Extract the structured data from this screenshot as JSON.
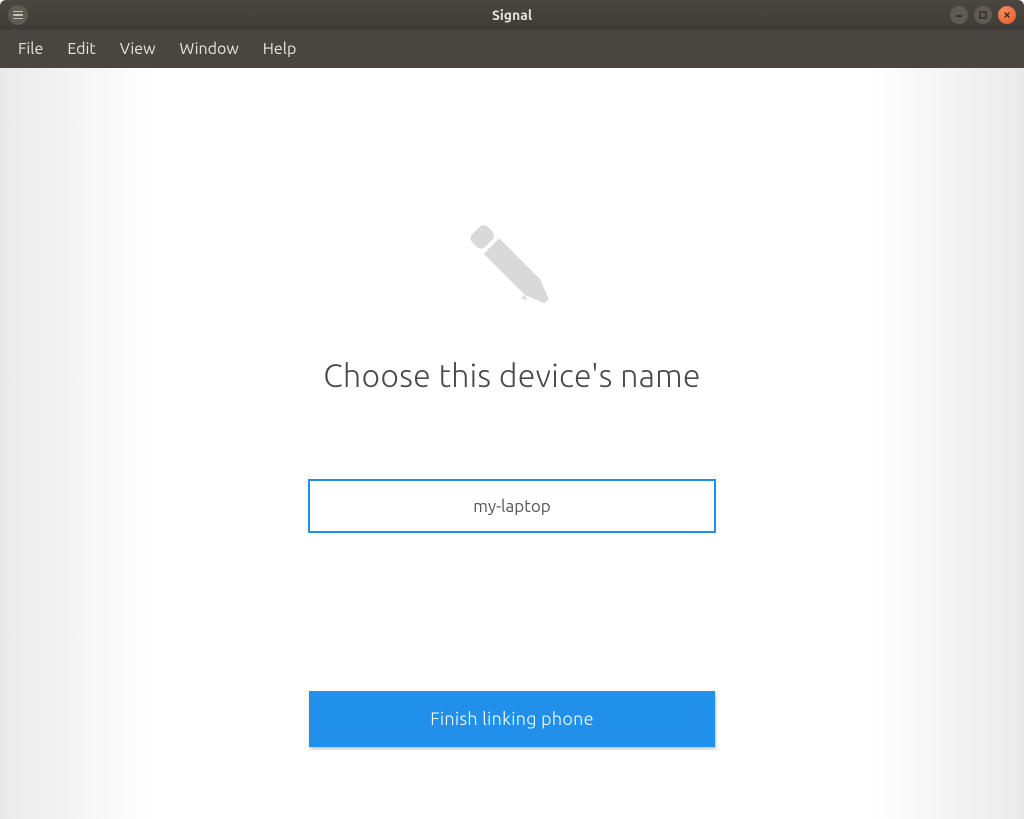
{
  "window": {
    "title": "Signal"
  },
  "menubar": {
    "items": [
      "File",
      "Edit",
      "View",
      "Window",
      "Help"
    ]
  },
  "main": {
    "heading": "Choose this device's name",
    "device_name_value": "my-laptop",
    "finish_button_label": "Finish linking phone"
  },
  "colors": {
    "accent": "#2090ea",
    "titlebar": "#3f3b35",
    "close_button": "#e95420"
  }
}
